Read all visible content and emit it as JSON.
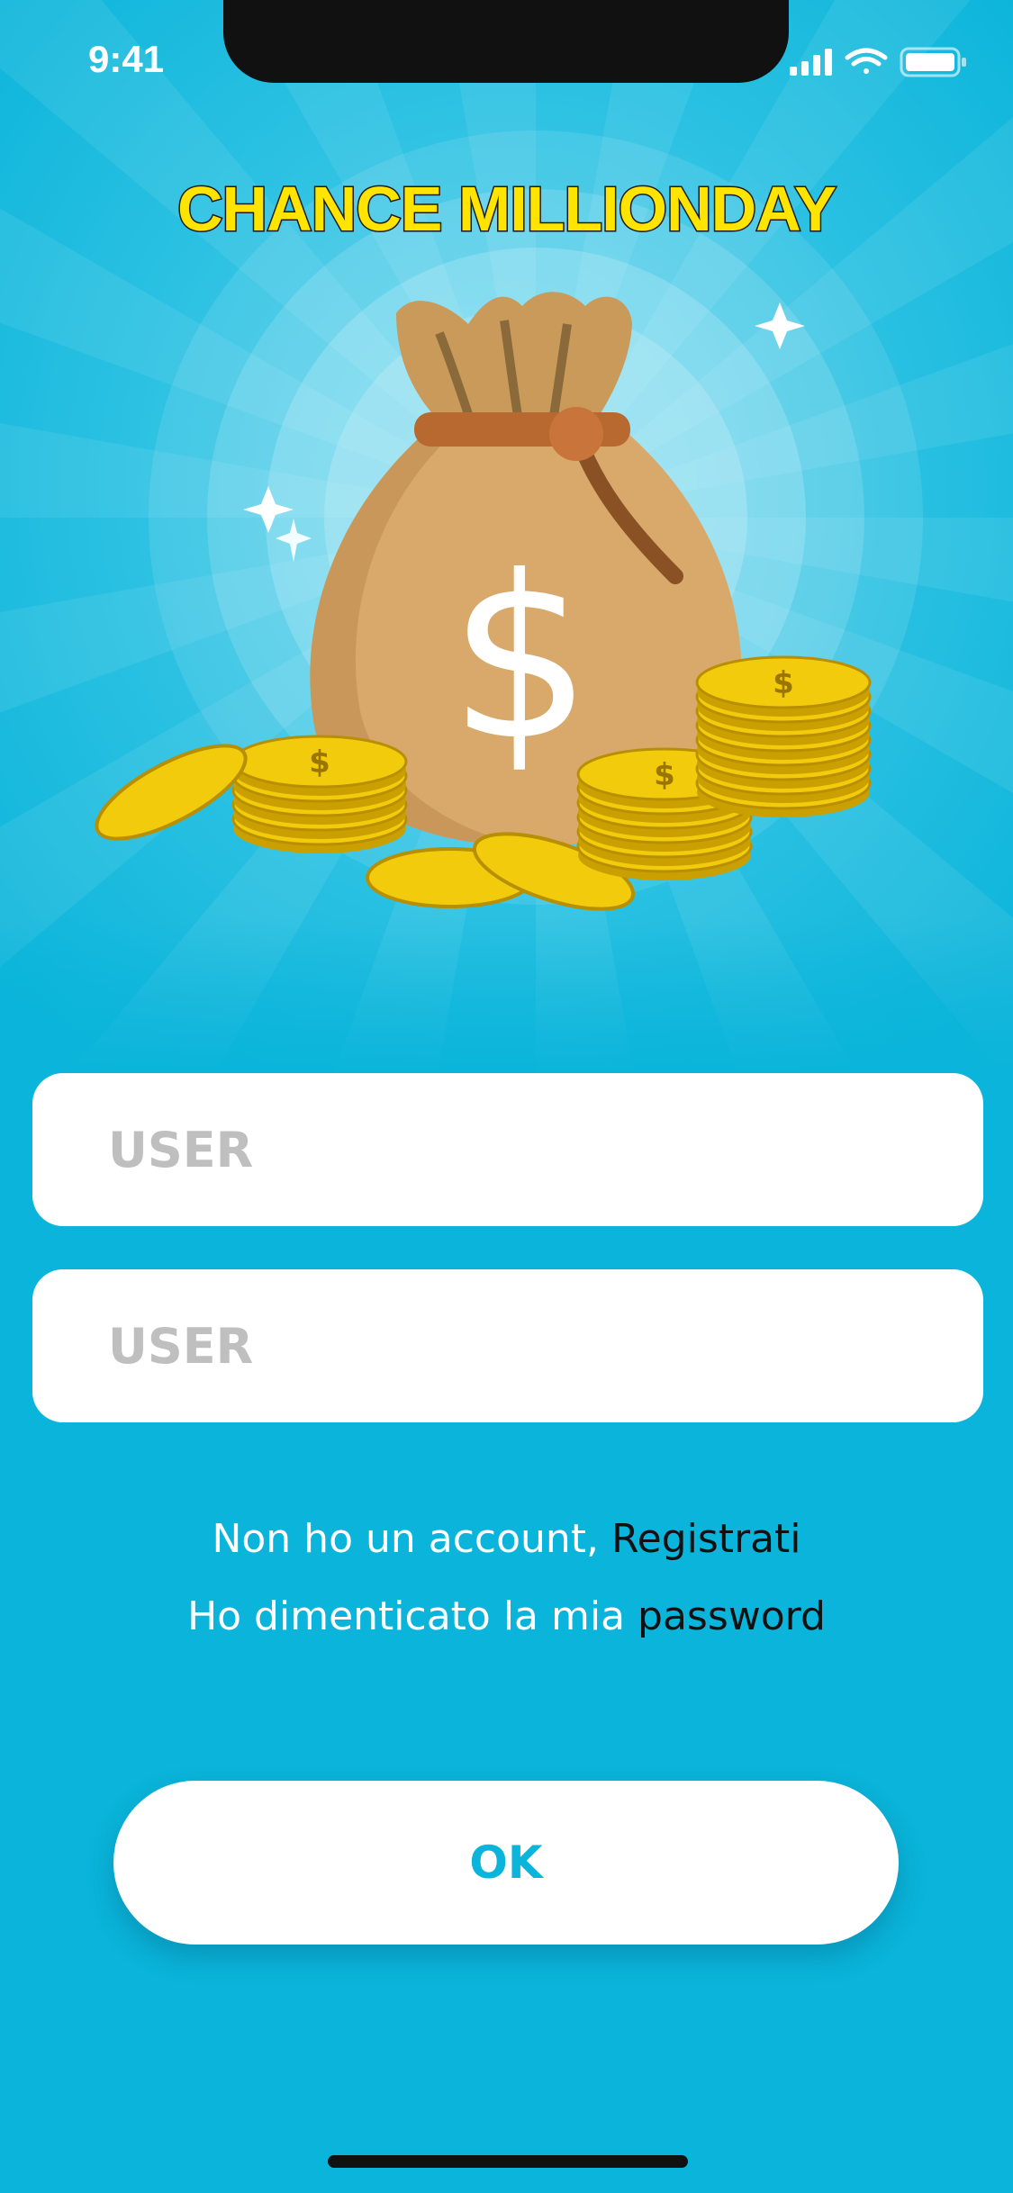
{
  "status_bar": {
    "time": "9:41",
    "icons": [
      "cellular-signal-icon",
      "wifi-icon",
      "battery-icon"
    ]
  },
  "app": {
    "title": "CHANCE MILLIONDAY"
  },
  "hero": {
    "illustration": "money-bag-with-gold-coins",
    "bag_symbol": "$"
  },
  "form": {
    "user_placeholder": "USER",
    "password_placeholder": "USER"
  },
  "links": {
    "register_prefix": "Non ho un account, ",
    "register_link": "Registrati",
    "forgot_prefix": "Ho dimenticato la mia ",
    "forgot_link": "password"
  },
  "actions": {
    "ok_label": "OK"
  },
  "colors": {
    "background": "#0ab4da",
    "title_yellow": "#ffe400",
    "bag": "#d8a96a",
    "coin": "#f2cc0c",
    "button_text": "#0ab4da"
  }
}
